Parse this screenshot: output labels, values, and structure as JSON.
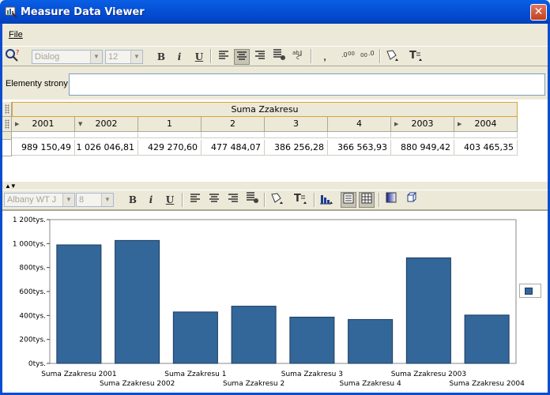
{
  "window": {
    "title": "Measure Data Viewer",
    "close_glyph": "✕"
  },
  "menu": {
    "file_label": "File"
  },
  "toolbar1": {
    "font": "Dialog",
    "size": "12",
    "bold": "B",
    "italic": "i",
    "underline": "U"
  },
  "toolbar2": {
    "font": "Albany WT J",
    "size": "8",
    "bold": "B",
    "italic": "i",
    "underline": "U"
  },
  "elements": {
    "label": "Elementy strony",
    "value": ""
  },
  "pivot": {
    "group_header": "Suma Zzakresu",
    "columns": [
      "2001",
      "2002",
      "1",
      "2",
      "3",
      "4",
      "2003",
      "2004"
    ],
    "expanded": [
      false,
      true,
      false,
      false,
      false,
      false,
      false,
      false
    ],
    "values": [
      "989 150,49",
      "1 026 046,81",
      "429 270,60",
      "477 484,07",
      "386 256,28",
      "366 563,93",
      "880 949,42",
      "403 465,35"
    ]
  },
  "colors": {
    "bar": "#336699",
    "bar_edge": "#1C3C60"
  },
  "chart_data": {
    "type": "bar",
    "categories": [
      "Suma Zzakresu 2001",
      "Suma Zzakresu 2002",
      "Suma Zzakresu 1",
      "Suma Zzakresu 2",
      "Suma Zzakresu 3",
      "Suma Zzakresu 4",
      "Suma Zzakresu 2003",
      "Suma Zzakresu 2004"
    ],
    "values": [
      989150.49,
      1026046.81,
      429270.6,
      477484.07,
      386256.28,
      366563.93,
      880949.42,
      403465.35
    ],
    "yticks": [
      "0tys.",
      "200tys.",
      "400tys.",
      "600tys.",
      "800tys.",
      "1 000tys.",
      "1 200tys."
    ],
    "ylim": [
      0,
      1200000
    ],
    "title": "",
    "xlabel": "",
    "ylabel": "",
    "grid": false,
    "legend": "right"
  }
}
